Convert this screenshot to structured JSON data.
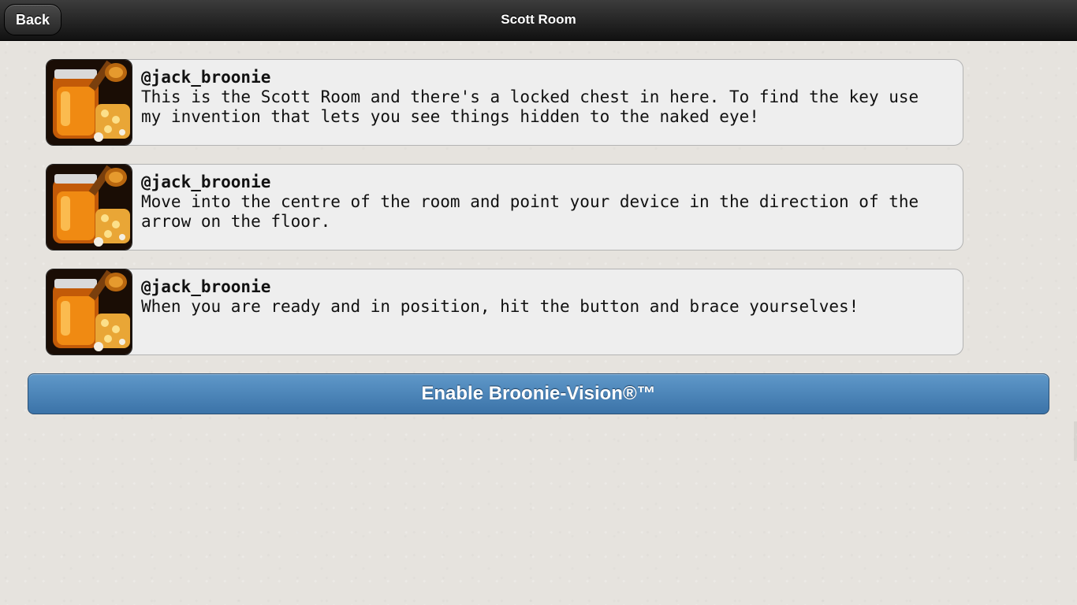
{
  "header": {
    "title": "Scott Room",
    "back_label": "Back"
  },
  "messages": [
    {
      "user": "@jack_broonie",
      "text": "This is the Scott Room and there's a locked chest in here. To find the key use my invention that lets you see things hidden to the naked eye!",
      "avatar_icon": "honey-jar-icon"
    },
    {
      "user": "@jack_broonie",
      "text": "Move into the centre of the room and point your device in the direction of the arrow on the floor.",
      "avatar_icon": "honey-jar-icon"
    },
    {
      "user": "@jack_broonie",
      "text": "When you are ready and in position, hit the button and brace yourselves!",
      "avatar_icon": "honey-jar-icon"
    }
  ],
  "action": {
    "enable_label": "Enable Broonie-Vision®™"
  },
  "colors": {
    "header_bg": "#1a1a1a",
    "button_blue": "#4a84b8",
    "bubble_bg": "#eeeeee",
    "page_bg": "#e6e3de"
  }
}
